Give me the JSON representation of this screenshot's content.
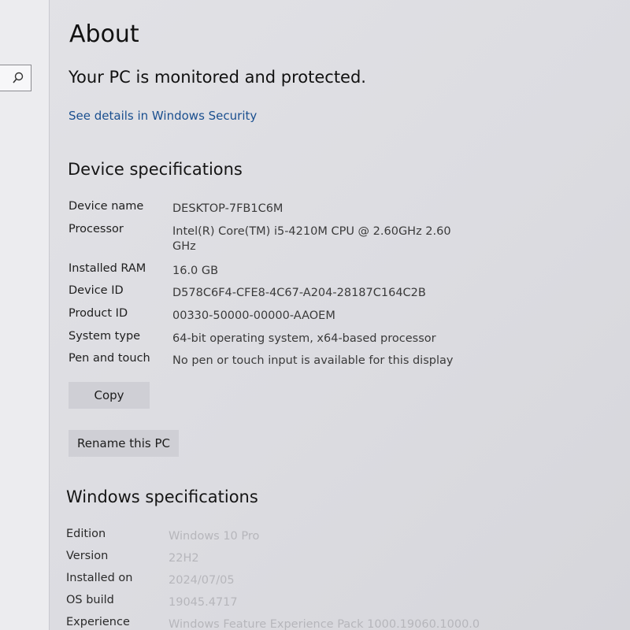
{
  "sidebar": {
    "search_icon": "search-icon"
  },
  "page": {
    "title": "About",
    "protection_status": "Your PC is monitored and protected.",
    "security_link": "See details in Windows Security"
  },
  "device_specifications": {
    "heading": "Device specifications",
    "rows": [
      {
        "label": "Device name",
        "value": "DESKTOP-7FB1C6M"
      },
      {
        "label": "Processor",
        "value": "Intel(R) Core(TM) i5-4210M CPU @ 2.60GHz   2.60 GHz"
      },
      {
        "label": "Installed RAM",
        "value": "16.0 GB"
      },
      {
        "label": "Device ID",
        "value": "D578C6F4-CFE8-4C67-A204-28187C164C2B"
      },
      {
        "label": "Product ID",
        "value": "00330-50000-00000-AAOEM"
      },
      {
        "label": "System type",
        "value": "64-bit operating system, x64-based processor"
      },
      {
        "label": "Pen and touch",
        "value": "No pen or touch input is available for this display"
      }
    ],
    "copy_label": "Copy",
    "rename_label": "Rename this PC"
  },
  "windows_specifications": {
    "heading": "Windows specifications",
    "rows": [
      {
        "label": "Edition",
        "value": "Windows 10 Pro"
      },
      {
        "label": "Version",
        "value": "22H2"
      },
      {
        "label": "Installed on",
        "value": "2024/07/05"
      },
      {
        "label": "OS build",
        "value": "19045.4717"
      },
      {
        "label": "Experience",
        "value": "Windows Feature Experience Pack 1000.19060.1000.0"
      }
    ]
  },
  "colors": {
    "link": "#1a4f8f",
    "button": "#cfcfd5",
    "background": "#dedee3"
  }
}
